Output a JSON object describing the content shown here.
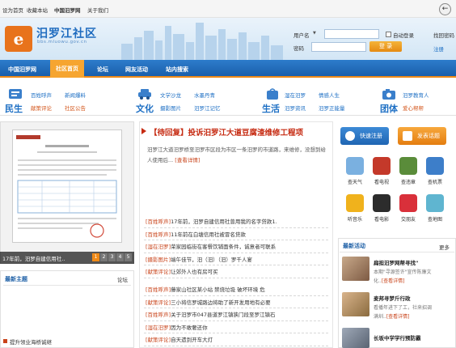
{
  "topbar": {
    "links": [
      "设为首页",
      "收藏本站",
      "中国汨罗网",
      "关于我们"
    ]
  },
  "header": {
    "logo_char": "e",
    "logo_title": "汨罗江社区",
    "logo_url": "bbs.mluowu.gov.cn"
  },
  "login": {
    "user_label": "用户名",
    "pwd_label": "密码",
    "auto_login": "自动登录",
    "forgot": "找回密码",
    "login_btn": "登 录",
    "register": "注册"
  },
  "nav": {
    "items": [
      "中国汨罗网",
      "社区首页",
      "论坛",
      "网友活动",
      "站内搜索"
    ],
    "active_index": 1
  },
  "categories": [
    {
      "title": "民生",
      "links": [
        "百姓呼声",
        "新闻爆料",
        "献策评论",
        "社区公告"
      ]
    },
    {
      "title": "文化",
      "links": [
        "文学沙龙",
        "水墨丹青",
        "摄影图片",
        "汨罗江记忆"
      ]
    },
    {
      "title": "生活",
      "links": [
        "湿在汨罗",
        "情感人生",
        "汨罗资讯",
        "汨罗正能量"
      ]
    },
    {
      "title": "团体",
      "links": [
        "汨罗教育人",
        "爱心帮帮"
      ]
    }
  ],
  "slider": {
    "caption": "17年前，汨罗自建信用社..",
    "pages": [
      "1",
      "2",
      "3",
      "4",
      "5"
    ],
    "active_page": 1
  },
  "headline": {
    "title": "【待回复】投诉汨罗江大道豆腐渣维修工程项",
    "body": "汨罗江大道汨罗桥至汨罗市区段为市区一条汨罗的市道路，来维修，没想到给人使用后...",
    "more": "[查看详情]"
  },
  "news_list": [
    {
      "tag": "[百姓呼声]",
      "text": "17年前，汨罗自建信用社曾用我的名字贷款1."
    },
    {
      "tag": "[百姓呼声]",
      "text": "11年前在白塘信用社被冒名贷款"
    },
    {
      "tag": "[湿在汨罗]",
      "text": "荣家园临街在客餐饮铺面条件，诚意者可联系"
    },
    {
      "tag": "[摄影图片]",
      "text": "端午佳节，汨（汨）（汨）罗千人宴"
    },
    {
      "tag": "[献策评论]",
      "text": "让郊外人也有房可买"
    }
  ],
  "news_list2": [
    {
      "tag": "[百姓呼声]",
      "text": "藤家山社区某小站 禁烧垃圾 破坏环境 危"
    },
    {
      "tag": "[献策评论]",
      "text": "三小将信罗城路边将助了新开发用地有必要"
    },
    {
      "tag": "[百姓呼声]",
      "text": "关于汨罗市047县道罗江镇狭门段至罗江镇石"
    },
    {
      "tag": "[湿在汨罗]",
      "text": "因为不敢奢还你"
    },
    {
      "tag": "[献策评论]",
      "text": "自天遗到开车大灯"
    }
  ],
  "latest": {
    "title": "最新主题",
    "more": "论坛",
    "first_item": "提升领业海桥诚继"
  },
  "quick": {
    "register": "快速注册",
    "post": "发表话题"
  },
  "apps": [
    {
      "label": "查天气",
      "color": "#7ab0e0"
    },
    {
      "label": "看电视",
      "color": "#c4392a"
    },
    {
      "label": "查违章",
      "color": "#5a8c3a"
    },
    {
      "label": "查机票",
      "color": "#3d7ec9"
    },
    {
      "label": "听音乐",
      "color": "#f0b21c"
    },
    {
      "label": "看电影",
      "color": "#2c2c2c"
    },
    {
      "label": "交朋友",
      "color": "#d9303a"
    },
    {
      "label": "查地图",
      "color": "#5fb5d0"
    }
  ],
  "activity": {
    "title": "最新活动",
    "more": "更多",
    "items": [
      {
        "title": "扁担汨罗网帮寻找\"",
        "desc": "本期\"寻源签许\"宣传陈廉文",
        "desc2": "化..",
        "more": "[查看详情]"
      },
      {
        "title": "麦邦寻梦斤行政",
        "desc": "看播年进下了工，社来招调",
        "desc2": "满圳..",
        "more": "[查看详情]"
      },
      {
        "title": "长坂中学学行预防霸",
        "desc": "",
        "desc2": "",
        "more": ""
      }
    ]
  }
}
